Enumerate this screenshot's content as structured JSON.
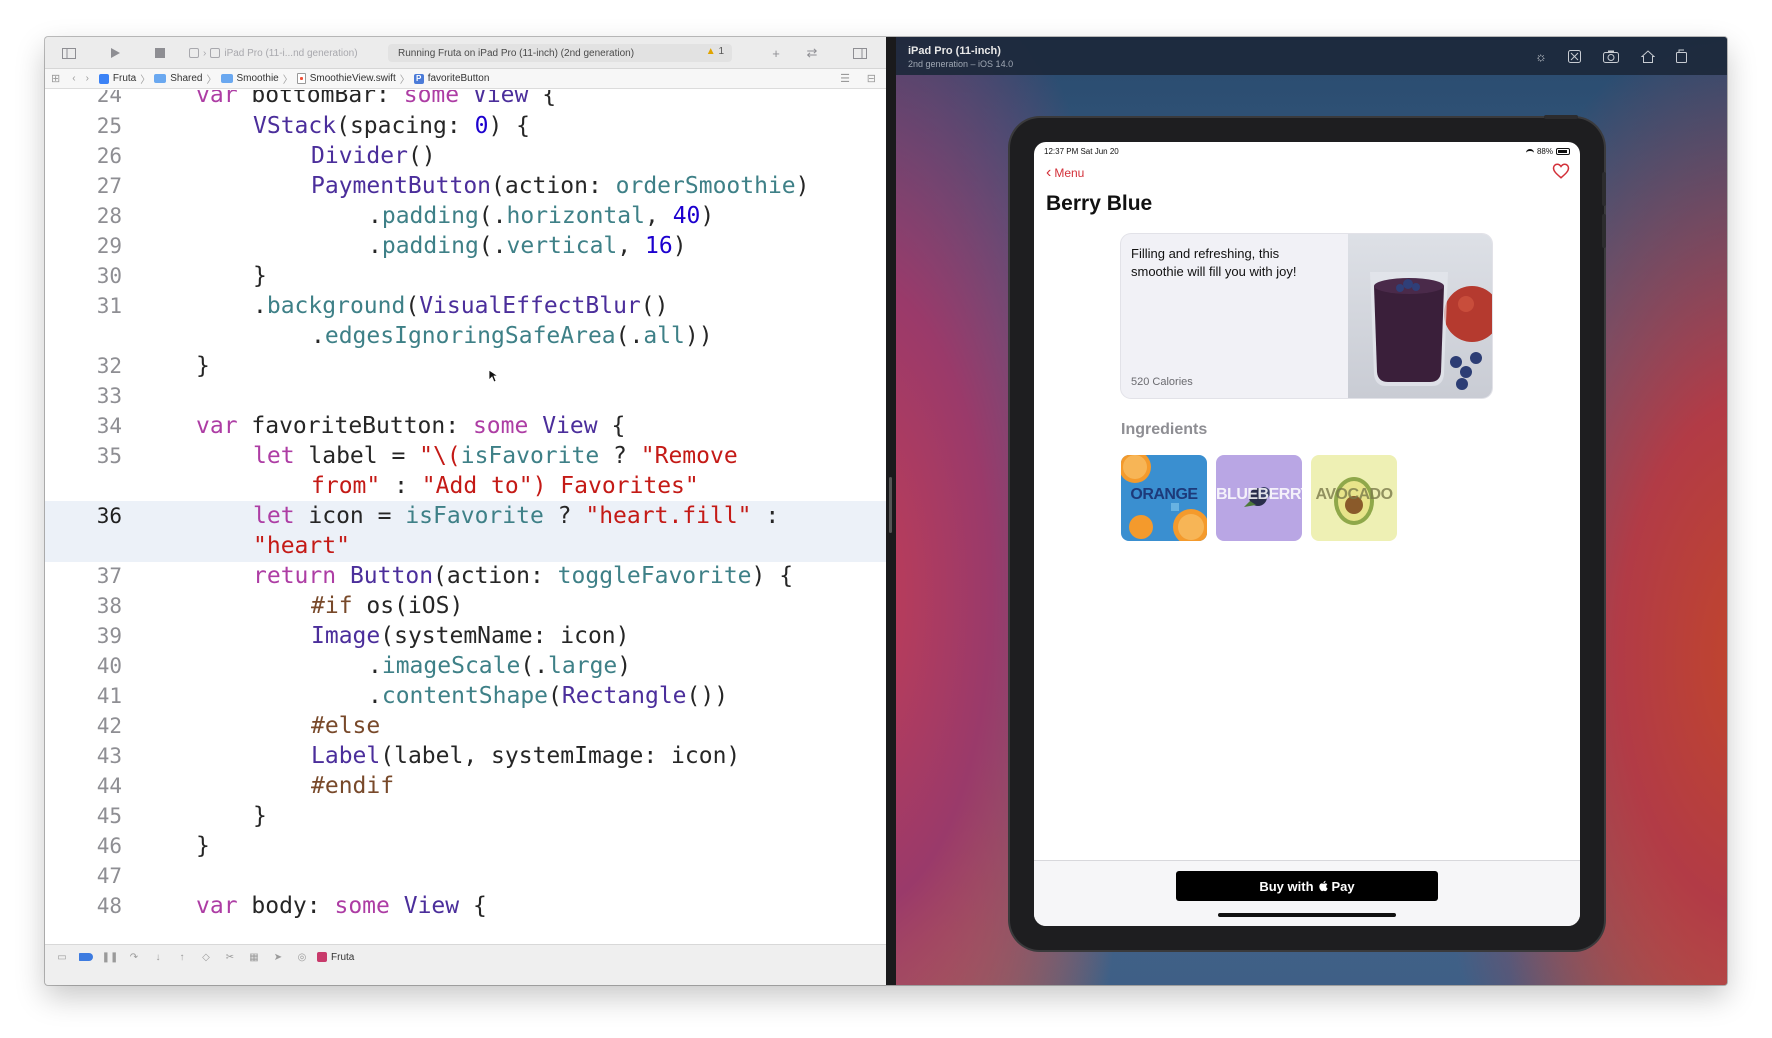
{
  "xcode": {
    "toolbar": {
      "scheme_device": "iPad Pro (11-i...nd generation)",
      "activity": "Running Fruta on iPad Pro (11-inch) (2nd generation)",
      "warning_count": "1"
    },
    "jumpbar": {
      "crumbs": [
        "Fruta",
        "Shared",
        "Smoothie",
        "SmoothieView.swift",
        "favoriteButton"
      ]
    },
    "editor": {
      "line_numbers": [
        "24",
        "25",
        "26",
        "27",
        "28",
        "29",
        "30",
        "31",
        "",
        "32",
        "33",
        "34",
        "35",
        "",
        "36",
        "",
        "37",
        "38",
        "39",
        "40",
        "41",
        "42",
        "43",
        "44",
        "45",
        "46",
        "47",
        "48"
      ],
      "current_line": "36"
    },
    "debugbar": {
      "scheme": "Fruta"
    }
  },
  "simulator": {
    "device_name": "iPad Pro (11-inch)",
    "device_sub": "2nd generation – iOS 14.0",
    "toolbar_icons": [
      "brightness-icon",
      "accessibility-icon",
      "screenshot-icon",
      "home-icon",
      "rotate-icon"
    ]
  },
  "app": {
    "status_time": "12:37 PM   Sat Jun 20",
    "battery": "88%",
    "back_label": "Menu",
    "title": "Berry Blue",
    "description": "Filling and refreshing, this smoothie will fill you with joy!",
    "calories": "520 Calories",
    "ingredients_title": "Ingredients",
    "ingredients": [
      {
        "label": "ORANGE",
        "color": "#3a8fd0"
      },
      {
        "label": "BLUEBERRY",
        "color": "#b9a6e4"
      },
      {
        "label": "AVOCADO",
        "color": "#eef0b4"
      }
    ],
    "buy_label": "Buy with",
    "pay_label": "Pay"
  },
  "colors": {
    "keyword": "#ad3da4",
    "type": "#4b2e9b",
    "member": "#3e8087",
    "string": "#c41a16",
    "number": "#1c00cf",
    "accent_red": "#d3313a"
  }
}
